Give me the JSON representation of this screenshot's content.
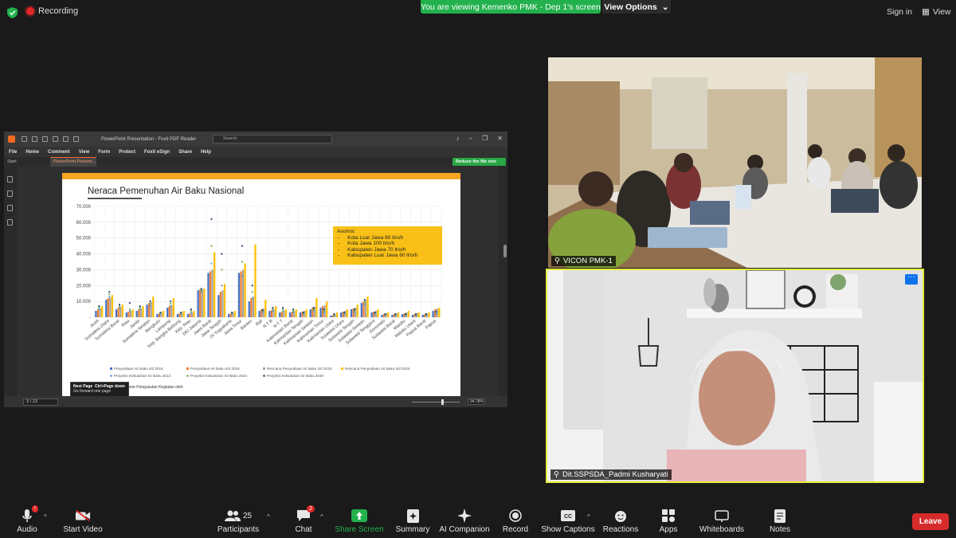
{
  "topbar": {
    "recording_label": "Recording",
    "viewing_banner": "You are viewing Kemenko PMK - Dep 1's screen",
    "view_options_label": "View Options",
    "signin_label": "Sign in",
    "view_label": "View"
  },
  "foxit": {
    "window_title": "PowerPoint Presentation - Foxit PDF Reader",
    "search_placeholder": "Search",
    "menu": [
      "File",
      "Home",
      "Comment",
      "View",
      "Form",
      "Protect",
      "Foxit eSign",
      "Share",
      "Help"
    ],
    "tab_start": "Start",
    "tab_doc": "PowerPoint Present...",
    "reduce_label": "Reduce the file size",
    "tooltip_title": "Next Page",
    "tooltip_shortcut": "Ctrl+Page down",
    "tooltip_desc": "Go forward one page",
    "page_indicator": "3 / 13",
    "zoom_level": "94.78%",
    "slide_footer": "...n Mekanisme Pengusulan Kegiatan oleh"
  },
  "chart_data": {
    "type": "bar",
    "title": "Neraca Pemenuhan Air Baku Nasional",
    "ylim": [
      0,
      70000
    ],
    "yticks": [
      "-",
      "10.000",
      "20.000",
      "30.000",
      "40.000",
      "50.000",
      "60.000",
      "70.000"
    ],
    "grid": true,
    "legend_position": "bottom",
    "categories": [
      "Aceh",
      "Sumatera Utara",
      "Sumatera Barat",
      "Riau",
      "Jambi",
      "Sumatera Selatan",
      "Bengkulu",
      "Lampung",
      "Kep. Bangka Belitung",
      "Kep. Riau",
      "DKI Jakarta",
      "Jawa Barat",
      "Jawa Tengah",
      "DI Yogyakarta",
      "Jawa Timur",
      "Banten",
      "Bali",
      "N T B",
      "N T T",
      "Kalimantan Barat",
      "Kalimantan Tengah",
      "Kalimantan Selatan",
      "Kalimantan Timur",
      "Kalimantan Utara",
      "Sulawesi Utara",
      "Sulawesi Tengah",
      "Sulawesi Selatan",
      "Sulawesi Tenggara",
      "Gorontalo",
      "Sulawesi Barat",
      "Maluku",
      "Maluku Utara",
      "Papua Barat",
      "Papua"
    ],
    "series": [
      {
        "name": "Penyediaan Air Baku s/d 2015",
        "color": "#4472c4",
        "kind": "bar",
        "values": [
          4000,
          11000,
          5000,
          3000,
          4000,
          8000,
          2000,
          6000,
          2000,
          2000,
          17000,
          28000,
          14000,
          2000,
          28000,
          10000,
          4000,
          4000,
          3000,
          3000,
          3000,
          5000,
          6000,
          1000,
          3000,
          5000,
          9000,
          3000,
          1500,
          1500,
          2000,
          1500,
          1500,
          4000
        ]
      },
      {
        "name": "Penyediaan Air Baku s/d 2018",
        "color": "#ed7d31",
        "kind": "bar",
        "values": [
          5000,
          12000,
          6000,
          3500,
          5000,
          9000,
          2500,
          7000,
          2500,
          2500,
          17500,
          29000,
          16000,
          2500,
          29000,
          12000,
          5000,
          4500,
          3500,
          3500,
          3500,
          6000,
          7000,
          1500,
          3500,
          5500,
          10000,
          3500,
          2000,
          2000,
          2500,
          2000,
          2000,
          5000
        ]
      },
      {
        "name": "Rencana Penyediaan Air Baku s/d 2019",
        "color": "#a5a5a5",
        "kind": "bar",
        "values": [
          5500,
          12500,
          6500,
          4000,
          5500,
          9500,
          3000,
          7500,
          3000,
          3000,
          17800,
          30000,
          17000,
          3000,
          30000,
          13000,
          5500,
          5000,
          4000,
          4000,
          4000,
          6500,
          7500,
          2000,
          4000,
          6000,
          11000,
          4000,
          2500,
          2500,
          3000,
          2500,
          2500,
          5500
        ]
      },
      {
        "name": "Rencana Penyediaan Air Baku s/d 2024",
        "color": "#ffc000",
        "kind": "bar",
        "values": [
          7000,
          14000,
          8000,
          5000,
          7000,
          13000,
          4000,
          12000,
          4000,
          4000,
          18000,
          41000,
          21000,
          4000,
          34000,
          46000,
          11000,
          7000,
          5000,
          5000,
          5000,
          12000,
          10000,
          3000,
          5000,
          8000,
          13000,
          5000,
          3000,
          3000,
          4000,
          3000,
          3000,
          6000
        ]
      },
      {
        "name": "Proyeksi Kebutuhan Air Baku 2013",
        "color": "#5b9bd5",
        "kind": "point",
        "values": [
          5000,
          13000,
          6000,
          4000,
          5000,
          7000,
          2000,
          7000,
          2000,
          3000,
          16000,
          34000,
          20000,
          2000,
          26000,
          12000,
          3000,
          4000,
          4000,
          3000,
          2000,
          4000,
          3000,
          1000,
          2000,
          3000,
          8000,
          2000,
          1000,
          1000,
          1000,
          1000,
          1000,
          2000
        ]
      },
      {
        "name": "Proyeksi Kebutuhan Air Baku 2024",
        "color": "#70ad47",
        "kind": "point",
        "values": [
          6000,
          14500,
          7000,
          5000,
          6000,
          8500,
          2500,
          8500,
          2500,
          4000,
          17000,
          45000,
          30000,
          2500,
          35000,
          16000,
          4000,
          5000,
          5000,
          4000,
          2500,
          5000,
          4000,
          1500,
          2500,
          4000,
          9500,
          2500,
          1500,
          1500,
          1500,
          1500,
          1500,
          3000
        ]
      },
      {
        "name": "Proyeksi Kebutuhan Air Baku 2030",
        "color": "#264478",
        "kind": "point",
        "values": [
          7000,
          16000,
          8000,
          9000,
          7000,
          10000,
          3000,
          10000,
          3000,
          5000,
          18000,
          62000,
          40000,
          3000,
          45000,
          20000,
          4500,
          6000,
          6000,
          5000,
          3000,
          6000,
          5000,
          2000,
          3000,
          5000,
          11000,
          3000,
          2000,
          2000,
          2000,
          2000,
          2000,
          3500
        ]
      }
    ]
  },
  "asumsi": {
    "title": "Asumsi:",
    "items": [
      "Kota Luar Jawa 80 lt/o/h",
      "Kota Jawa 100 lt/o/h",
      "Kabupaten Jawa 70 lt/o/h",
      "Kabupaten Luar Jawa 60 lt/o/h"
    ]
  },
  "tiles": {
    "room_name": "VICON PMK-1",
    "speaker_name": "Dit.SSPSDA_Padmi Kusharyati"
  },
  "toolbar": {
    "audio": "Audio",
    "audio_badge": "!",
    "video": "Start Video",
    "participants": "Participants",
    "participants_count": "25",
    "chat": "Chat",
    "chat_badge": "2",
    "share": "Share Screen",
    "summary": "Summary",
    "ai": "AI Companion",
    "record": "Record",
    "captions": "Show Captions",
    "reactions": "Reactions",
    "apps": "Apps",
    "whiteboards": "Whiteboards",
    "notes": "Notes",
    "leave": "Leave"
  },
  "colors": {
    "share_green": "#23b14d",
    "leave_red": "#d72b2b",
    "active_speaker": "#e3ef37",
    "foxit_orange": "#f26b22"
  }
}
